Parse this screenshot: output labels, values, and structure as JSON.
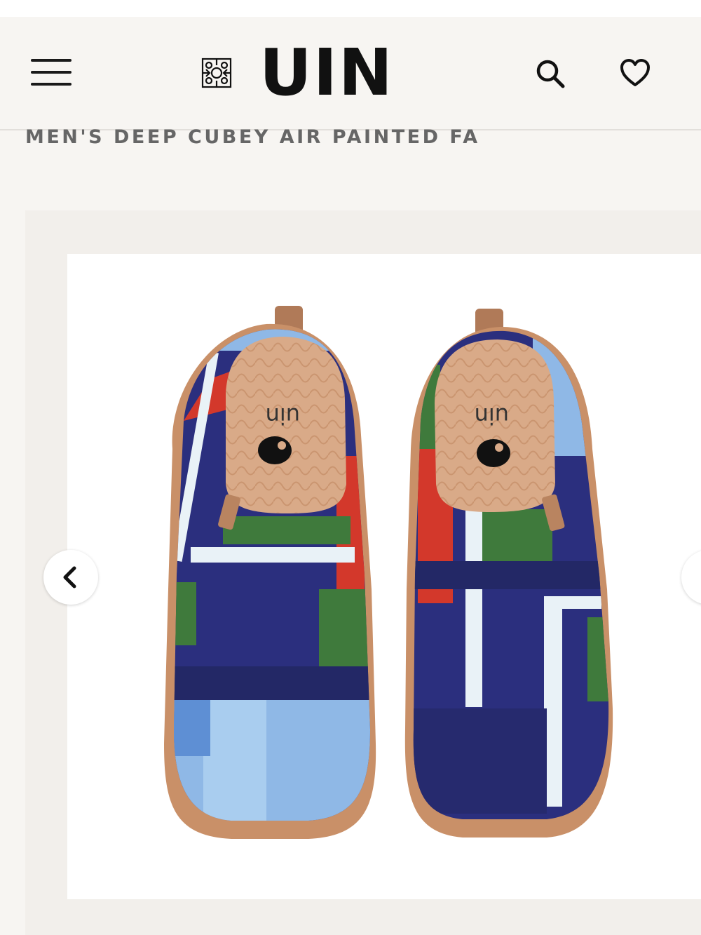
{
  "header": {
    "brand": "UIN",
    "menu_icon": "hamburger-menu-icon",
    "search_icon": "search-icon",
    "wishlist_icon": "heart-icon"
  },
  "product": {
    "title": "MEN'S DEEP CUBEY AIR PAINTED FA",
    "image_alt": "Men's Deep Cubey Air painted slip-on shoes, top view",
    "insole_brand": "uin"
  },
  "gallery": {
    "prev_icon": "chevron-left-icon",
    "next_icon": "chevron-right-icon"
  },
  "colors": {
    "navy": "#2a2f7d",
    "green": "#3f7a3c",
    "red": "#d3382b",
    "light_blue": "#8fb8e6",
    "sole_tan": "#c99068",
    "insole": "#d9aa88"
  }
}
